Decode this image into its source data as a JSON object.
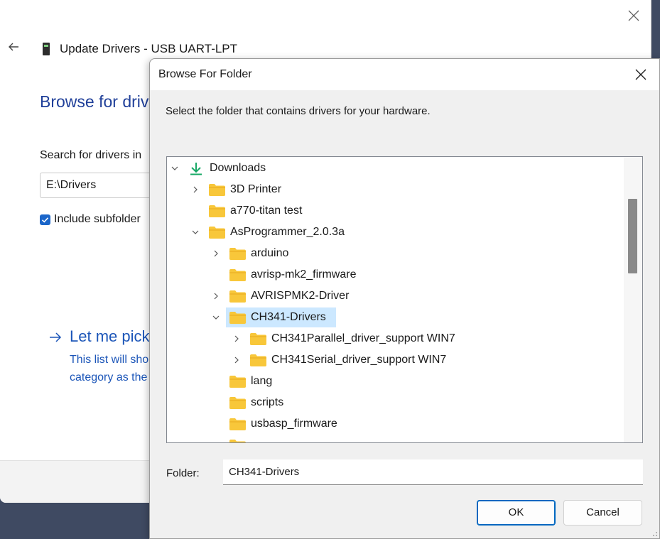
{
  "background_window": {
    "title": "Update Drivers - USB UART-LPT",
    "heading": "Browse for drive",
    "search_label": "Search for drivers in",
    "path_value": "E:\\Drivers",
    "include_subfolders_label": "Include subfolder",
    "include_subfolders_checked": true,
    "let_me_pick_link": "Let me pick",
    "let_me_pick_desc_line1": "This list will sho",
    "let_me_pick_desc_line2": "category as the"
  },
  "dialog": {
    "title": "Browse For Folder",
    "prompt": "Select the folder that contains drivers for your hardware.",
    "tree": [
      {
        "label": "Downloads",
        "depth": 0,
        "expander": "expanded",
        "icon": "download-arrow-icon"
      },
      {
        "label": "3D Printer",
        "depth": 1,
        "expander": "collapsed",
        "icon": "folder-icon"
      },
      {
        "label": "a770-titan test",
        "depth": 1,
        "expander": "none",
        "icon": "folder-icon"
      },
      {
        "label": "AsProgrammer_2.0.3a",
        "depth": 1,
        "expander": "expanded",
        "icon": "folder-icon"
      },
      {
        "label": "arduino",
        "depth": 2,
        "expander": "collapsed",
        "icon": "folder-icon"
      },
      {
        "label": "avrisp-mk2_firmware",
        "depth": 2,
        "expander": "none",
        "icon": "folder-icon"
      },
      {
        "label": "AVRISPMK2-Driver",
        "depth": 2,
        "expander": "collapsed",
        "icon": "folder-icon"
      },
      {
        "label": "CH341-Drivers",
        "depth": 2,
        "expander": "expanded",
        "icon": "folder-icon",
        "selected": true
      },
      {
        "label": "CH341Parallel_driver_support WIN7",
        "depth": 3,
        "expander": "collapsed",
        "icon": "folder-icon"
      },
      {
        "label": "CH341Serial_driver_support WIN7",
        "depth": 3,
        "expander": "collapsed",
        "icon": "folder-icon"
      },
      {
        "label": "lang",
        "depth": 2,
        "expander": "none",
        "icon": "folder-icon"
      },
      {
        "label": "scripts",
        "depth": 2,
        "expander": "none",
        "icon": "folder-icon"
      },
      {
        "label": "usbasp_firmware",
        "depth": 2,
        "expander": "none",
        "icon": "folder-icon"
      },
      {
        "label": "",
        "depth": 2,
        "expander": "none",
        "icon": "folder-icon"
      }
    ],
    "folder_label": "Folder:",
    "folder_value": "CH341-Drivers",
    "ok_label": "OK",
    "cancel_label": "Cancel"
  },
  "colors": {
    "accent": "#0067c0",
    "heading_blue": "#1f3f99",
    "link_blue": "#1b55b8",
    "selection": "#cce8ff",
    "folder_yellow": "#f8c73a",
    "download_green": "#17a866"
  }
}
